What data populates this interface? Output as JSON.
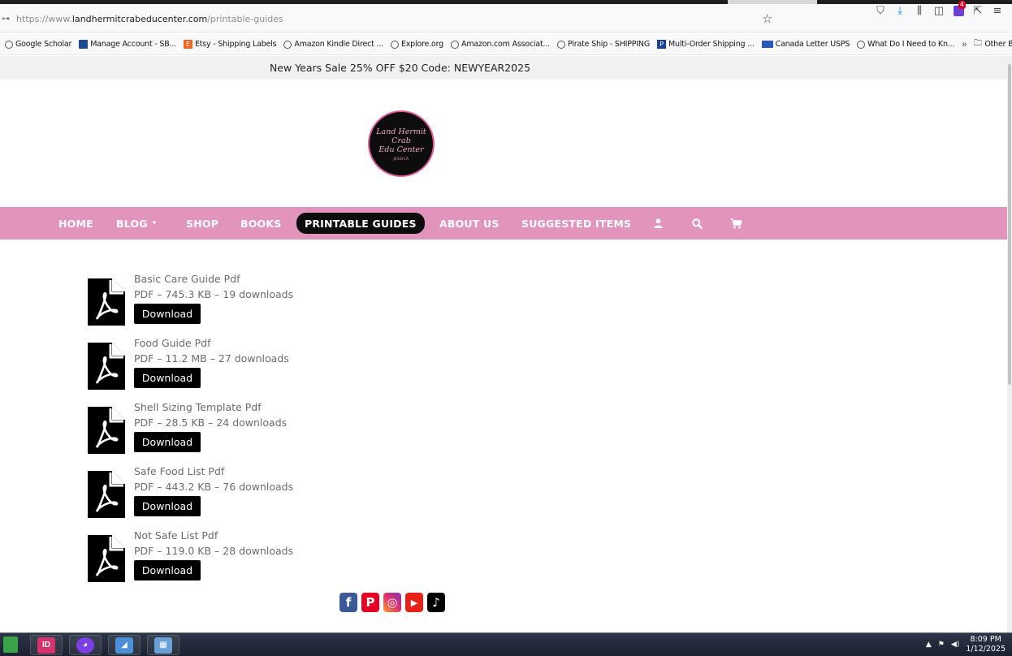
{
  "browser": {
    "url_proto": "https://www.",
    "url_domain": "landhermitcrabeducenter.com",
    "url_path": "/printable-guides",
    "extension_badge": "4",
    "bookmarks": [
      {
        "label": "Google Scholar",
        "icon": "globe-icon"
      },
      {
        "label": "Manage Account - SB...",
        "icon": "sb-icon"
      },
      {
        "label": "Etsy - Shipping Labels",
        "icon": "etsy-icon",
        "glyph": "E"
      },
      {
        "label": "Amazon Kindle Direct ...",
        "icon": "globe-icon"
      },
      {
        "label": "Explore.org",
        "icon": "globe-icon"
      },
      {
        "label": "Amazon.com Associat...",
        "icon": "globe-icon"
      },
      {
        "label": "Pirate Ship - SHIPPING",
        "icon": "globe-icon"
      },
      {
        "label": "Multi-Order Shipping ...",
        "icon": "paypal-icon",
        "glyph": "P"
      },
      {
        "label": "Canada Letter USPS",
        "icon": "usps-icon"
      },
      {
        "label": "What Do I Need to Kn...",
        "icon": "globe-icon"
      }
    ],
    "more_label": "»",
    "other_bookmarks": "Other Bookmarks"
  },
  "announcement": "New Years Sale 25% OFF $20 Code: NEWYEAR2025",
  "nav": {
    "items": [
      {
        "label": "HOME"
      },
      {
        "label": "BLOG"
      },
      {
        "label": "SHOP"
      },
      {
        "label": "BOOKS"
      },
      {
        "label": "PRINTABLE GUIDES"
      },
      {
        "label": "ABOUT US"
      },
      {
        "label": "SUGGESTED ITEMS"
      }
    ],
    "blog_caret": "▾",
    "icons": [
      "user-icon",
      "search-icon",
      "cart-icon"
    ]
  },
  "downloads": [
    {
      "title": "Basic Care Guide Pdf",
      "meta": "PDF – 745.3 KB – 19 downloads",
      "button": "Download"
    },
    {
      "title": "Food Guide Pdf",
      "meta": "PDF – 11.2 MB – 27 downloads",
      "button": "Download"
    },
    {
      "title": "Shell Sizing Template Pdf",
      "meta": "PDF – 28.5 KB – 24 downloads",
      "button": "Download"
    },
    {
      "title": "Safe Food List Pdf",
      "meta": "PDF – 443.2 KB – 76 downloads",
      "button": "Download"
    },
    {
      "title": "Not Safe List Pdf",
      "meta": "PDF – 119.0 KB – 28 downloads",
      "button": "Download"
    }
  ],
  "social": [
    {
      "name": "facebook-icon",
      "glyph": "f"
    },
    {
      "name": "pinterest-icon",
      "glyph": "P"
    },
    {
      "name": "instagram-icon",
      "glyph": "◎"
    },
    {
      "name": "youtube-icon",
      "glyph": "▶"
    },
    {
      "name": "tiktok-icon",
      "glyph": "♪"
    }
  ],
  "taskbar": {
    "apps": [
      {
        "name": "indesign-app",
        "glyph": "ID",
        "color": "#d6336c"
      },
      {
        "name": "app-2",
        "glyph": "◕",
        "color": "#7b3fe4"
      },
      {
        "name": "app-3",
        "glyph": "◢",
        "color": "#4a8fd8"
      },
      {
        "name": "calculator-app",
        "glyph": "▦",
        "color": "#6aa0d8"
      }
    ],
    "time": "8:09 PM",
    "date": "1/12/2025"
  },
  "colors": {
    "nav_bg": "#e394bd",
    "active_nav_bg": "#0d0d0d",
    "announcement_bg": "#f1f1f1"
  }
}
